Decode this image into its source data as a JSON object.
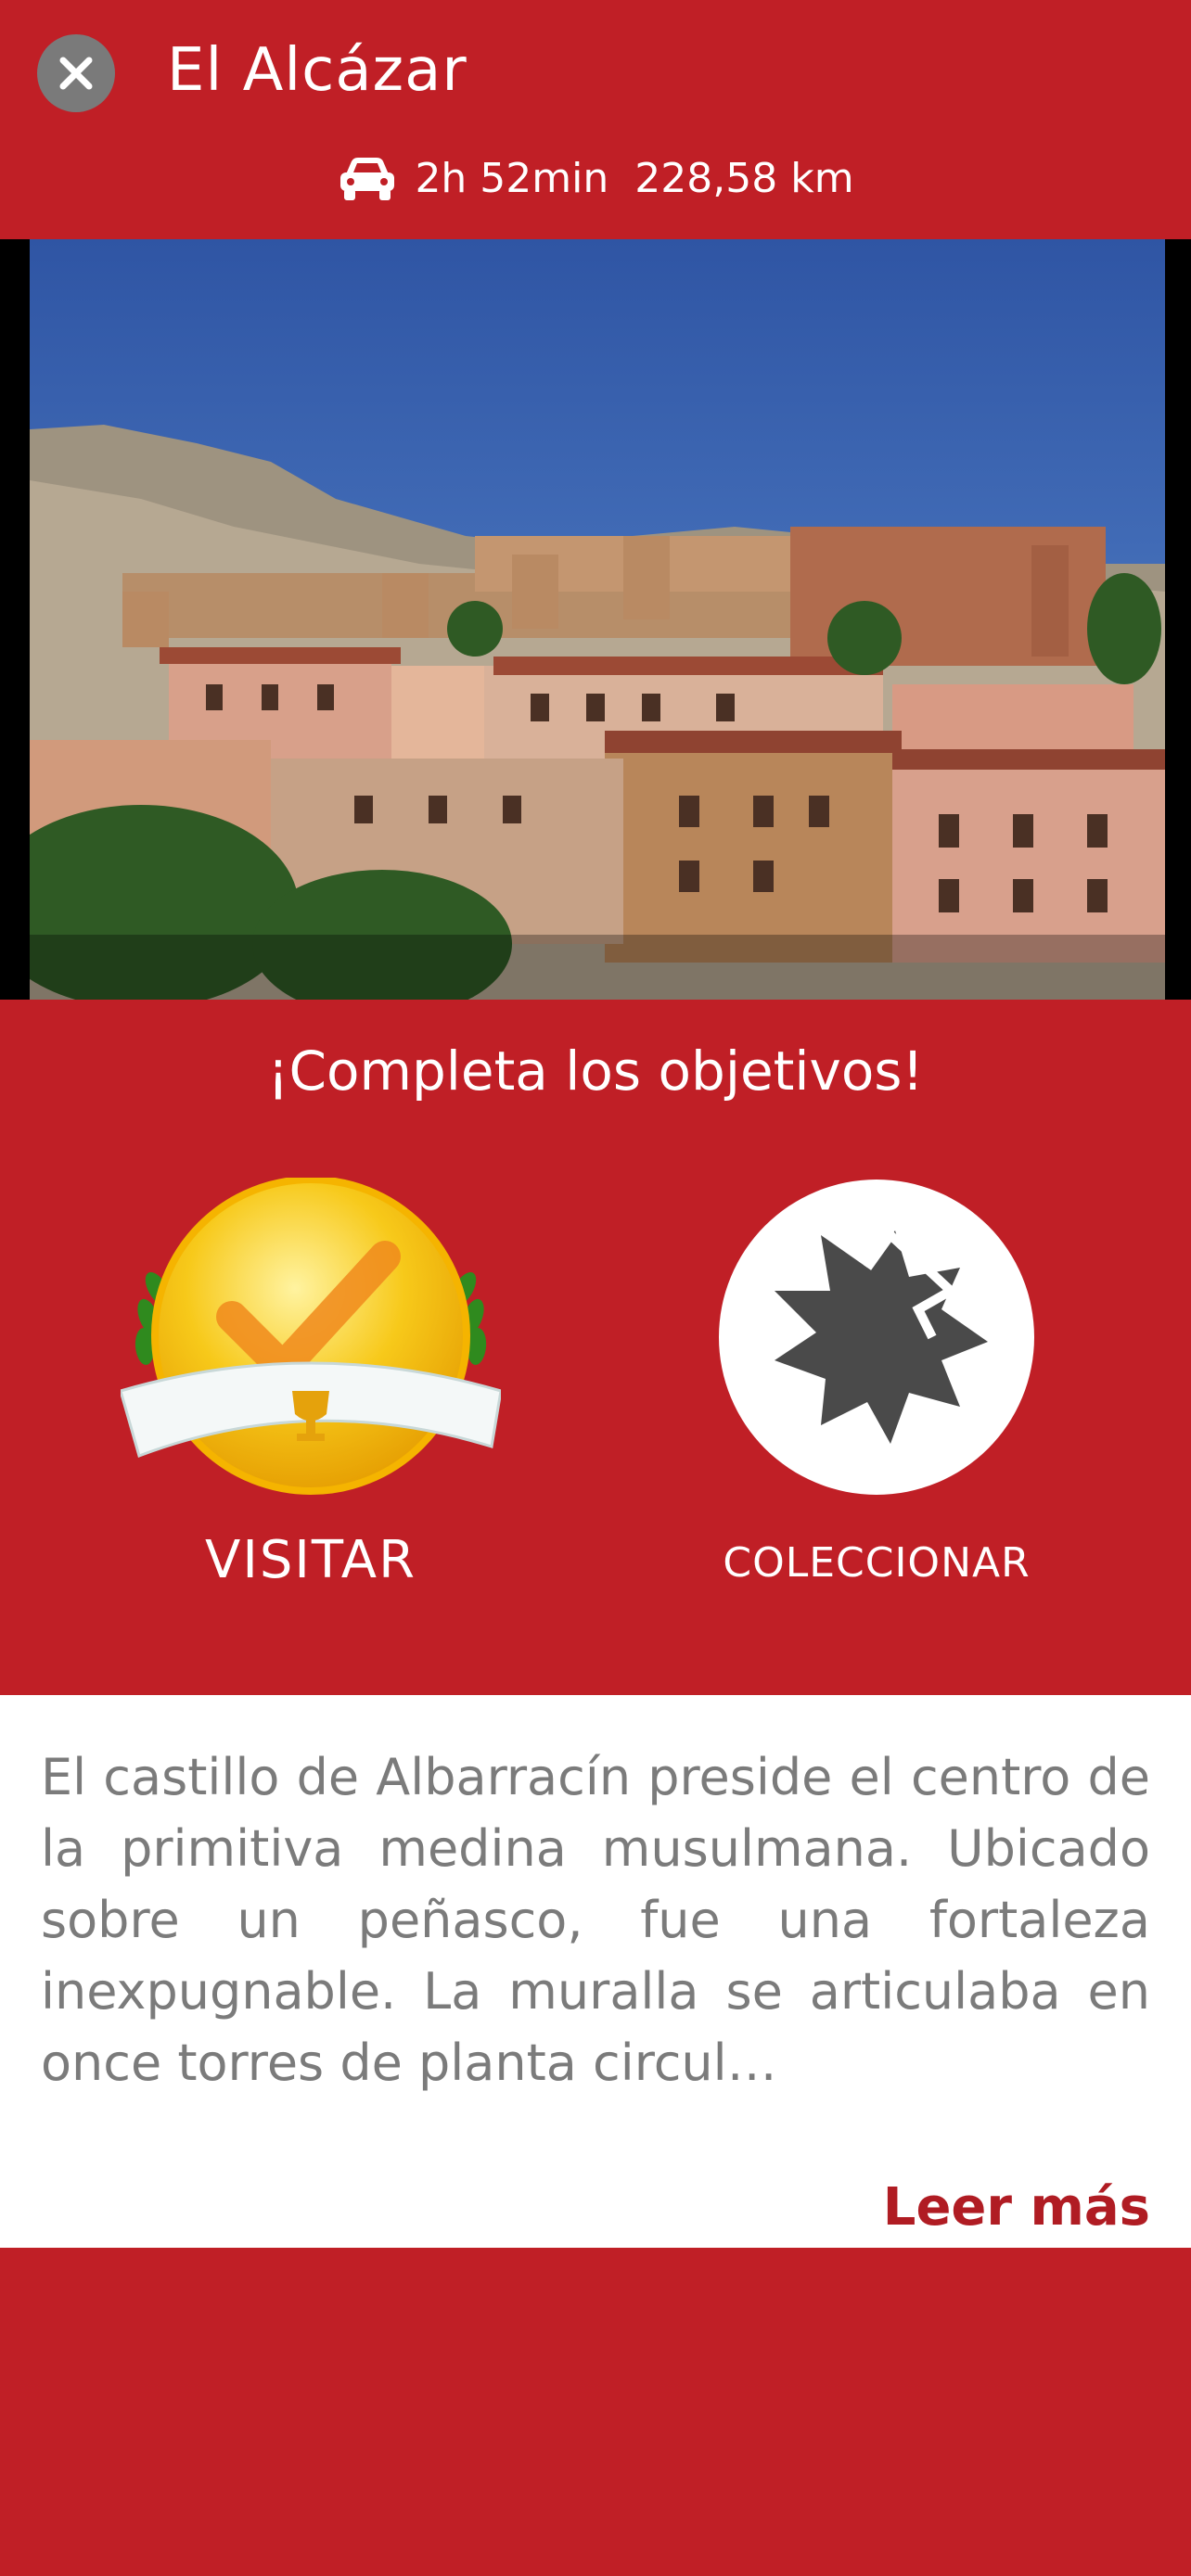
{
  "header": {
    "title": "El Alcázar",
    "route": {
      "icon": "car-icon",
      "duration": "2h 52min",
      "distance": "228,58 km"
    },
    "close_icon": "close-icon"
  },
  "photo": {
    "subject": "castle-walls-and-town-image"
  },
  "objectives": {
    "title": "¡Completa los objetivos!",
    "items": [
      {
        "label": "VISITAR",
        "icon": "gold-medal-check-icon",
        "completed": true
      },
      {
        "label": "COLECCIONAR",
        "icon": "collect-badge-icon",
        "completed": false
      }
    ]
  },
  "description": {
    "text": "El castillo de Albarracín preside el centro de la primitiva medina musulmana. Ubicado sobre un peñasco, fue una fortaleza inexpugnable. La muralla se articulaba en once torres de planta circul…",
    "read_more": "Leer más"
  },
  "colors": {
    "brand_red": "#c01f26",
    "link_red": "#b01c23",
    "text_gray": "#7b7b7b"
  }
}
